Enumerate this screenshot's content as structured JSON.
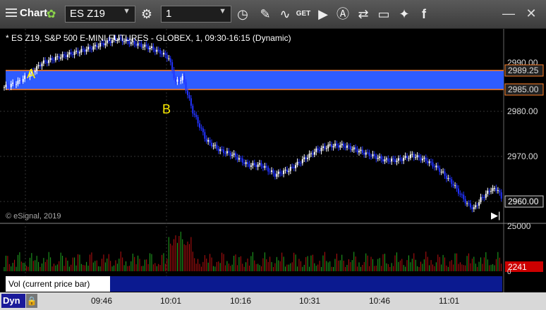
{
  "toolbar": {
    "title": "Chart",
    "symbol": "ES Z19",
    "interval": "1",
    "icons": [
      "menu-icon",
      "link-wheel-icon",
      "settings-icon",
      "clock-icon",
      "pencil-icon",
      "study-icon",
      "get-icon",
      "play-icon",
      "alert-icon",
      "share-icon",
      "comment-icon",
      "twitter-icon",
      "facebook-icon"
    ],
    "window_minimize": "—",
    "window_close": "✕"
  },
  "chart": {
    "header": "* ES Z19, S&P 500 E-MINI FUTURES - GLOBEX, 1, 09:30-16:15 (Dynamic)",
    "copyright": "© eSignal, 2019",
    "label_a": "A",
    "label_b": "B",
    "upper_level": "2989.25",
    "lower_level": "2985.00",
    "price_ticks": [
      "2990.00",
      "2980.00",
      "2970.00",
      "2960.00"
    ],
    "last_price": "2960.00",
    "zone_color": "#2e5cff",
    "line_color": "#ff7f27"
  },
  "volume": {
    "tick_top": "25000",
    "tick_bottom": "0",
    "current": "2241",
    "tab_label": "Vol (current price bar)",
    "close_glyph": "×"
  },
  "footer": {
    "dyn_label": "Dyn",
    "time_ticks": [
      "09:46",
      "10:01",
      "10:16",
      "10:31",
      "10:46",
      "11:01"
    ]
  },
  "chart_data": {
    "type": "candlestick",
    "ylim": [
      2955,
      2995
    ],
    "levels": [
      2989.25,
      2985.0
    ],
    "close_path": [
      [
        0,
        2983
      ],
      [
        8,
        2984
      ],
      [
        16,
        2986
      ],
      [
        22,
        2988
      ],
      [
        30,
        2989
      ],
      [
        40,
        2990
      ],
      [
        50,
        2991
      ],
      [
        58,
        2992
      ],
      [
        66,
        2993
      ],
      [
        76,
        2992
      ],
      [
        86,
        2991
      ],
      [
        92,
        2990
      ],
      [
        96,
        2989
      ],
      [
        100,
        2984
      ],
      [
        104,
        2985
      ],
      [
        110,
        2978
      ],
      [
        118,
        2972
      ],
      [
        126,
        2970
      ],
      [
        134,
        2969
      ],
      [
        142,
        2967
      ],
      [
        150,
        2967
      ],
      [
        158,
        2965
      ],
      [
        166,
        2966
      ],
      [
        174,
        2968
      ],
      [
        182,
        2970
      ],
      [
        190,
        2971
      ],
      [
        198,
        2971
      ],
      [
        206,
        2970
      ],
      [
        214,
        2969
      ],
      [
        222,
        2968
      ],
      [
        230,
        2968
      ],
      [
        238,
        2969
      ],
      [
        246,
        2968
      ],
      [
        254,
        2966
      ],
      [
        262,
        2963
      ],
      [
        270,
        2959
      ],
      [
        274,
        2958
      ],
      [
        278,
        2960
      ],
      [
        284,
        2962
      ],
      [
        288,
        2962
      ],
      [
        290,
        2960
      ]
    ]
  }
}
